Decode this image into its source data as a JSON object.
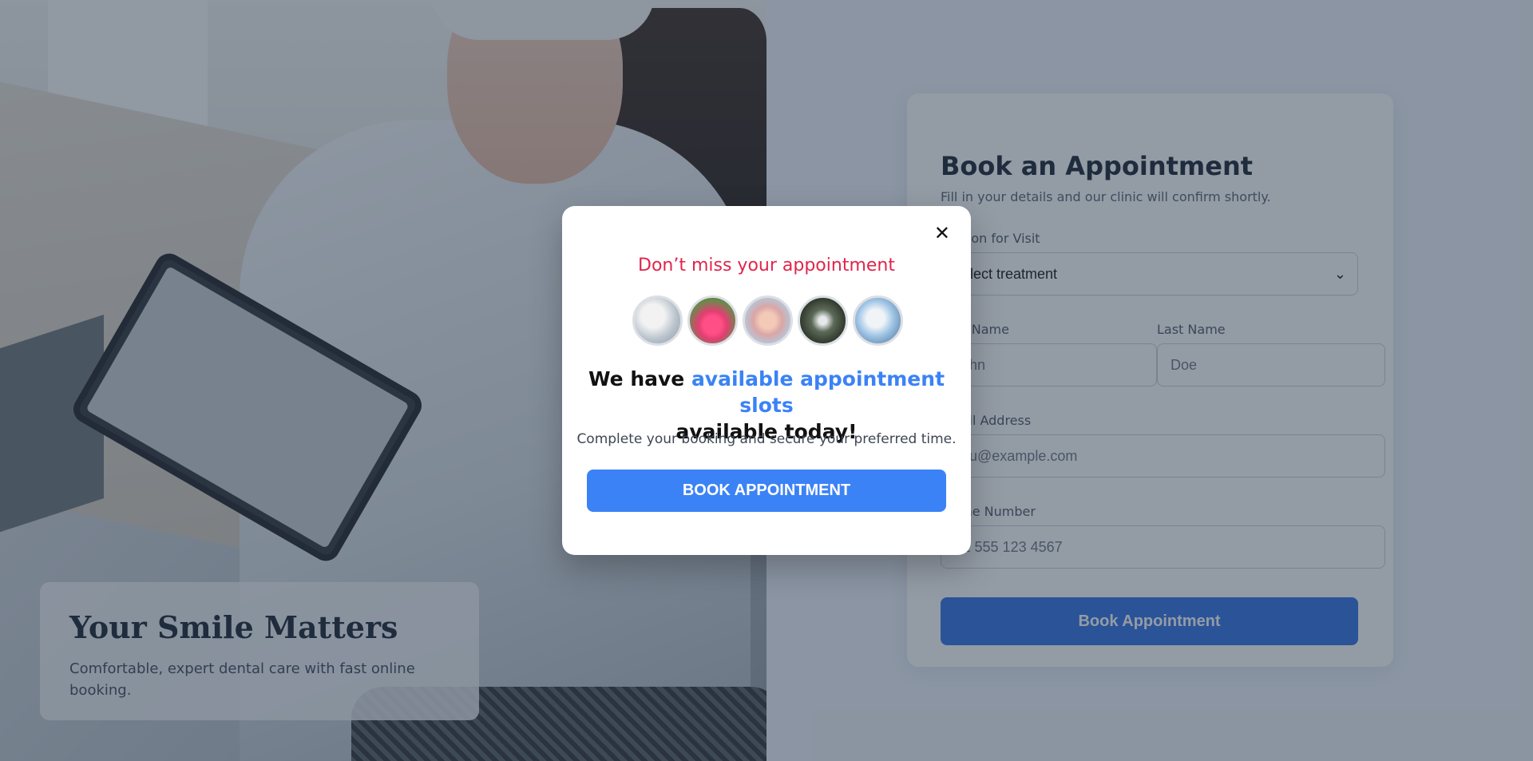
{
  "hero": {
    "title": "Your Smile Matters",
    "subtitle": "Comfortable, expert dental care with fast online booking."
  },
  "form": {
    "title": "Book an Appointment",
    "subtitle": "Fill in your details and our clinic will confirm shortly.",
    "reason_label": "Reason for Visit",
    "reason_value": "Select treatment",
    "first_name_label": "First Name",
    "first_name_placeholder": "John",
    "last_name_label": "Last Name",
    "last_name_placeholder": "Doe",
    "email_label": "Email Address",
    "email_placeholder": "you@example.com",
    "phone_label": "Phone Number",
    "phone_placeholder": "+1 555 123 4567",
    "submit_label": "Book Appointment"
  },
  "modal": {
    "close_glyph": "✕",
    "kicker": "Don’t miss your appointment",
    "heading_prefix": "We have ",
    "heading_highlight": "available appointment slots",
    "heading_suffix": "available today!",
    "subtitle": "Complete your booking and secure your preferred time.",
    "button_label": "BOOK APPOINTMENT"
  },
  "colors": {
    "accent": "#3b82f6",
    "kicker": "#e0254b",
    "submit": "#2f6fe4"
  }
}
